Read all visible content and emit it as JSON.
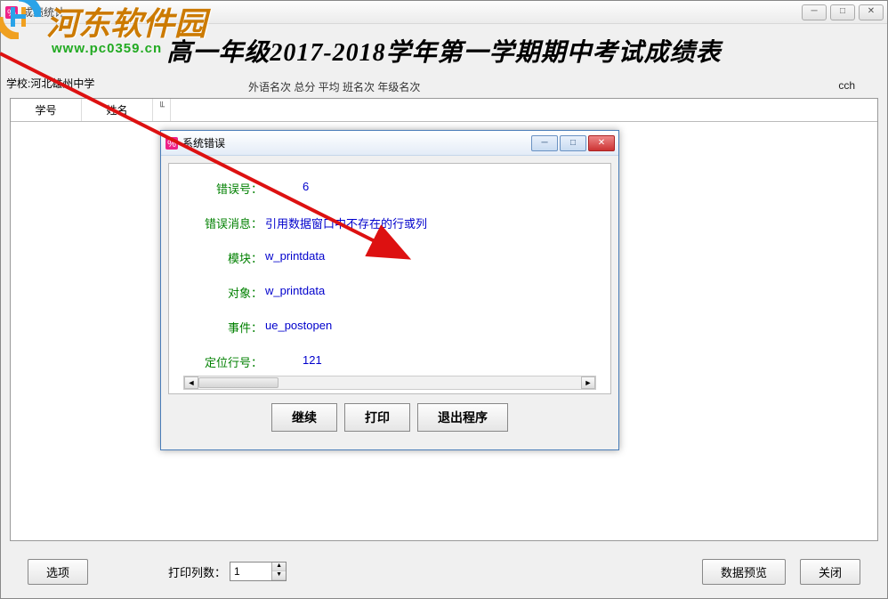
{
  "main": {
    "window_title": "成绩统计",
    "page_title": "高一年级2017-2018学年第一学期期中考试成绩表",
    "school_label": "学校:",
    "school_name": "河北雄州中学",
    "extra_cols": "外语名次  总分  平均  班名次  年级名次",
    "cch": "cch",
    "grid_headers": {
      "h1": "学号",
      "h2": "姓名"
    },
    "bottom": {
      "options_btn": "选项",
      "print_cols_label": "打印列数：",
      "print_cols_value": "1",
      "preview_btn": "数据预览",
      "close_btn": "关闭"
    }
  },
  "dialog": {
    "title": "系统错误",
    "rows": {
      "errno_label": "错误号",
      "errno_value": "6",
      "errmsg_label": "错误消息",
      "errmsg_value": "引用数据窗口中不存在的行或列",
      "module_label": "模块",
      "module_value": "w_printdata",
      "object_label": "对象",
      "object_value": "w_printdata",
      "event_label": "事件",
      "event_value": "ue_postopen",
      "line_label": "定位行号",
      "line_value": "121"
    },
    "buttons": {
      "continue": "继续",
      "print": "打印",
      "exit": "退出程序"
    }
  },
  "watermark": {
    "title": "河东软件园",
    "url": "www.pc0359.cn"
  }
}
